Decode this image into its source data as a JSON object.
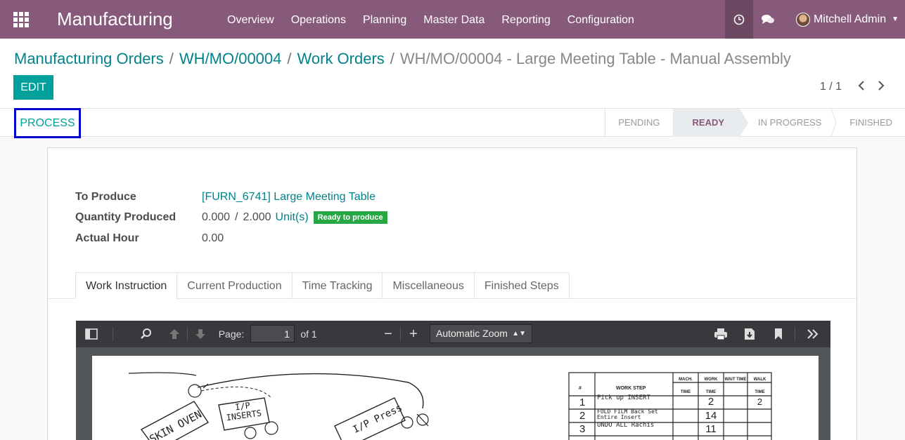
{
  "navbar": {
    "brand": "Manufacturing",
    "menu": [
      "Overview",
      "Operations",
      "Planning",
      "Master Data",
      "Reporting",
      "Configuration"
    ],
    "user": "Mitchell Admin",
    "background": "#875a7b"
  },
  "breadcrumb": {
    "items": [
      "Manufacturing Orders",
      "WH/MO/00004",
      "Work Orders"
    ],
    "separator": "/",
    "current": "WH/MO/00004 - Large Meeting Table - Manual Assembly"
  },
  "toolbar": {
    "edit_label": "EDIT",
    "pager_value": "1 / 1"
  },
  "statusbar": {
    "process_label": "PROCESS",
    "stages": [
      "PENDING",
      "READY",
      "IN PROGRESS",
      "FINISHED"
    ],
    "active_stage": "READY"
  },
  "form": {
    "to_produce_label": "To Produce",
    "to_produce_value": "[FURN_6741] Large Meeting Table",
    "qty_label": "Quantity Produced",
    "qty_produced": "0.000",
    "qty_sep": "/",
    "qty_total": "2.000",
    "qty_uom": "Unit(s)",
    "qty_badge": "Ready to produce",
    "hour_label": "Actual Hour",
    "hour_value": "0.00"
  },
  "tabs": [
    "Work Instruction",
    "Current Production",
    "Time Tracking",
    "Miscellaneous",
    "Finished Steps"
  ],
  "pdf": {
    "page_label": "Page:",
    "page_value": "1",
    "page_of": "of 1",
    "zoom": "Automatic Zoom",
    "drawing_labels": [
      "SKIN OVEN",
      "I/P INSERTS",
      "I/P Press"
    ],
    "table_headers": [
      "#",
      "WORK STEP",
      "MACH. TIME",
      "WORK TIME",
      "WAIT TIME",
      "WALK TIME"
    ],
    "table_rows": [
      {
        "n": "1",
        "step": "Pick up INSERT",
        "work": "2",
        "walk": "2"
      },
      {
        "n": "2",
        "step": "FOLD FILM Back Set Entire Insert",
        "work": "14",
        "walk": ""
      },
      {
        "n": "3",
        "step": "UNDO ALL Rachis",
        "work": "11",
        "walk": ""
      }
    ]
  },
  "icons": {
    "apps": "apps-grid-icon",
    "clock": "clock-icon",
    "chat": "chat-icon",
    "prev": "chevron-left-icon",
    "next": "chevron-right-icon"
  }
}
